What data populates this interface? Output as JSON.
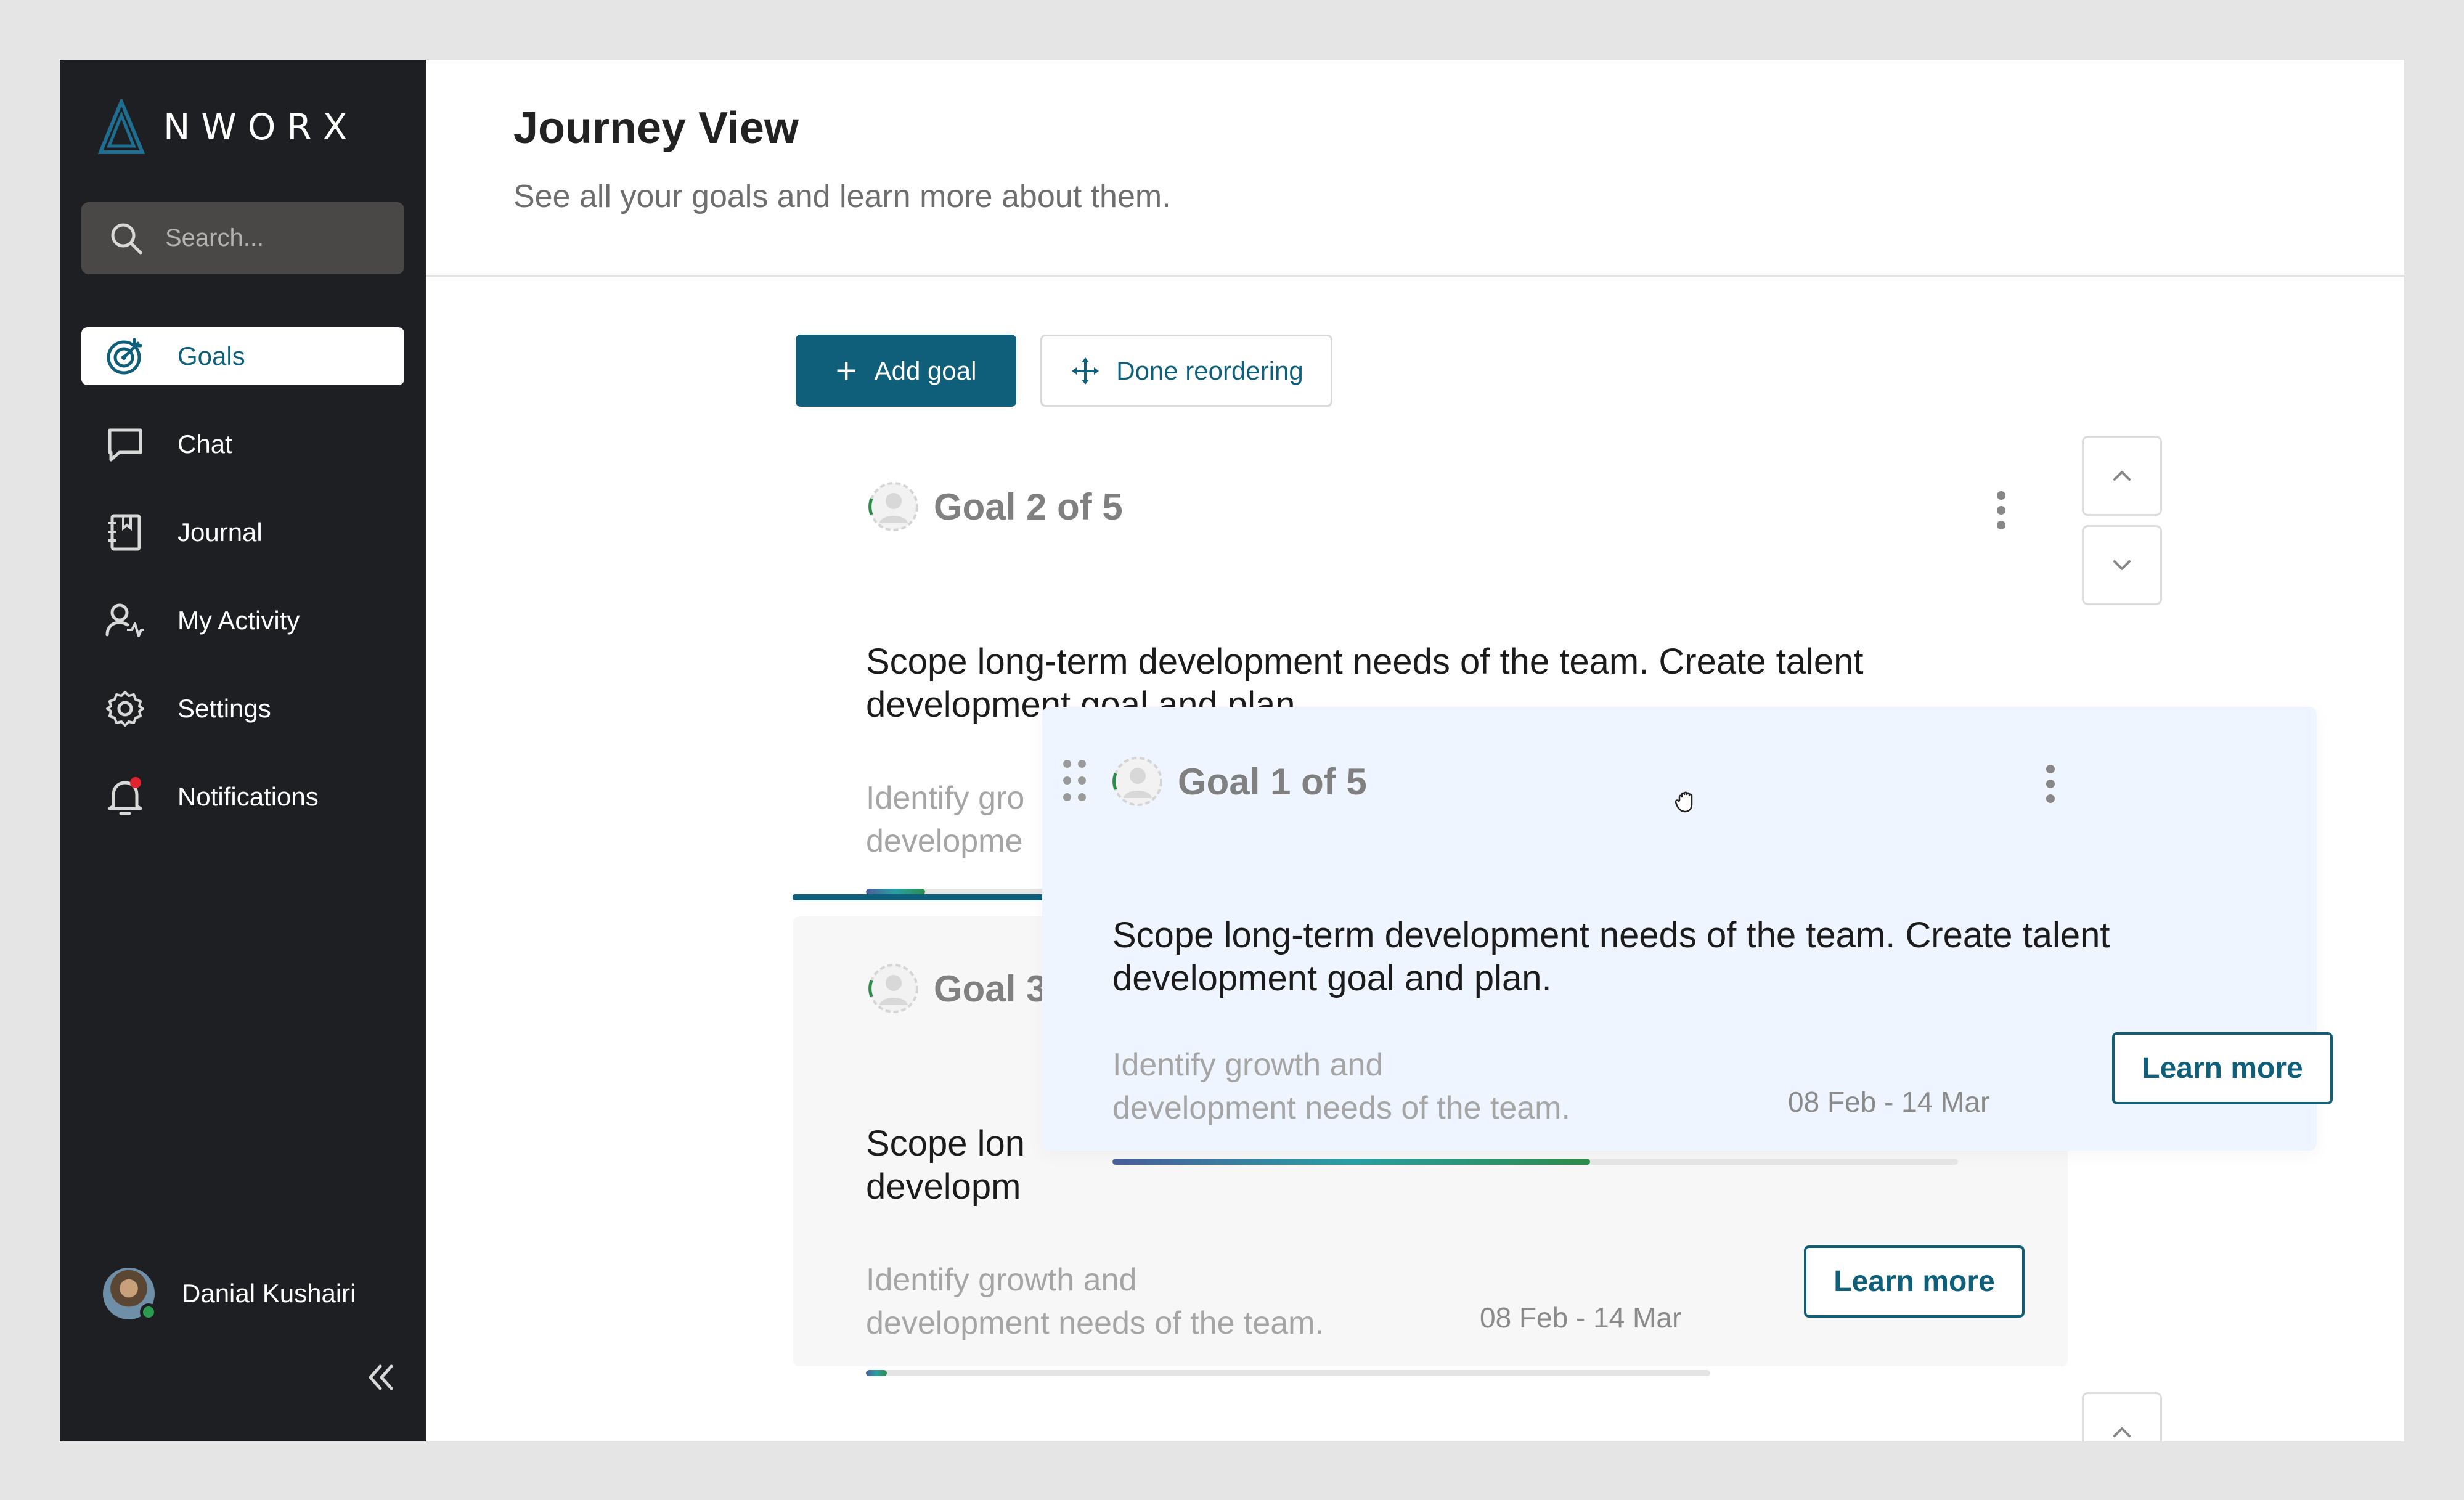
{
  "brand": {
    "name": "NWORX",
    "accent": "#0f5f7a"
  },
  "search": {
    "placeholder": "Search..."
  },
  "sidebar": {
    "items": [
      {
        "label": "Goals",
        "icon": "target-icon",
        "active": true
      },
      {
        "label": "Chat",
        "icon": "chat-bubble-icon"
      },
      {
        "label": "Journal",
        "icon": "journal-icon"
      },
      {
        "label": "My Activity",
        "icon": "user-activity-icon"
      },
      {
        "label": "Settings",
        "icon": "gear-icon"
      },
      {
        "label": "Notifications",
        "icon": "bell-icon",
        "badge_color": "#e0242f"
      }
    ],
    "user": {
      "name": "Danial Kushairi",
      "status": "online"
    },
    "collapse_icon": "double-chevron-left-icon"
  },
  "header": {
    "title": "Journey View",
    "subtitle": "See all your goals and learn more about them."
  },
  "toolbar": {
    "add_label": "Add goal",
    "done_label": "Done reordering"
  },
  "goals": [
    {
      "title": "Goal 2 of 5",
      "description": "Scope long-term development needs of the team. Create talent development goal and plan.",
      "subtext": "Identify growth and development needs of the team.",
      "subtext_visible": "Identify gro",
      "subtext_visible_2": "developme",
      "progress": 0.07
    },
    {
      "title": "Goal 1 of 5",
      "description": "Scope long-term development needs of the team. Create talent development goal and plan.",
      "subtext_line1": "Identify growth and",
      "subtext_line2": "development needs of the team.",
      "dates": "08 Feb - 14 Mar",
      "learn_label": "Learn more",
      "progress": 0.565,
      "state": "dragging"
    },
    {
      "title": "Goal 3",
      "description_line1": "Scope lon",
      "description_line2": "developm",
      "subtext_line1": "Identify growth and",
      "subtext_line2": "development needs of the team.",
      "dates": "08 Feb - 14 Mar",
      "learn_label": "Learn more",
      "progress": 0.025
    }
  ]
}
